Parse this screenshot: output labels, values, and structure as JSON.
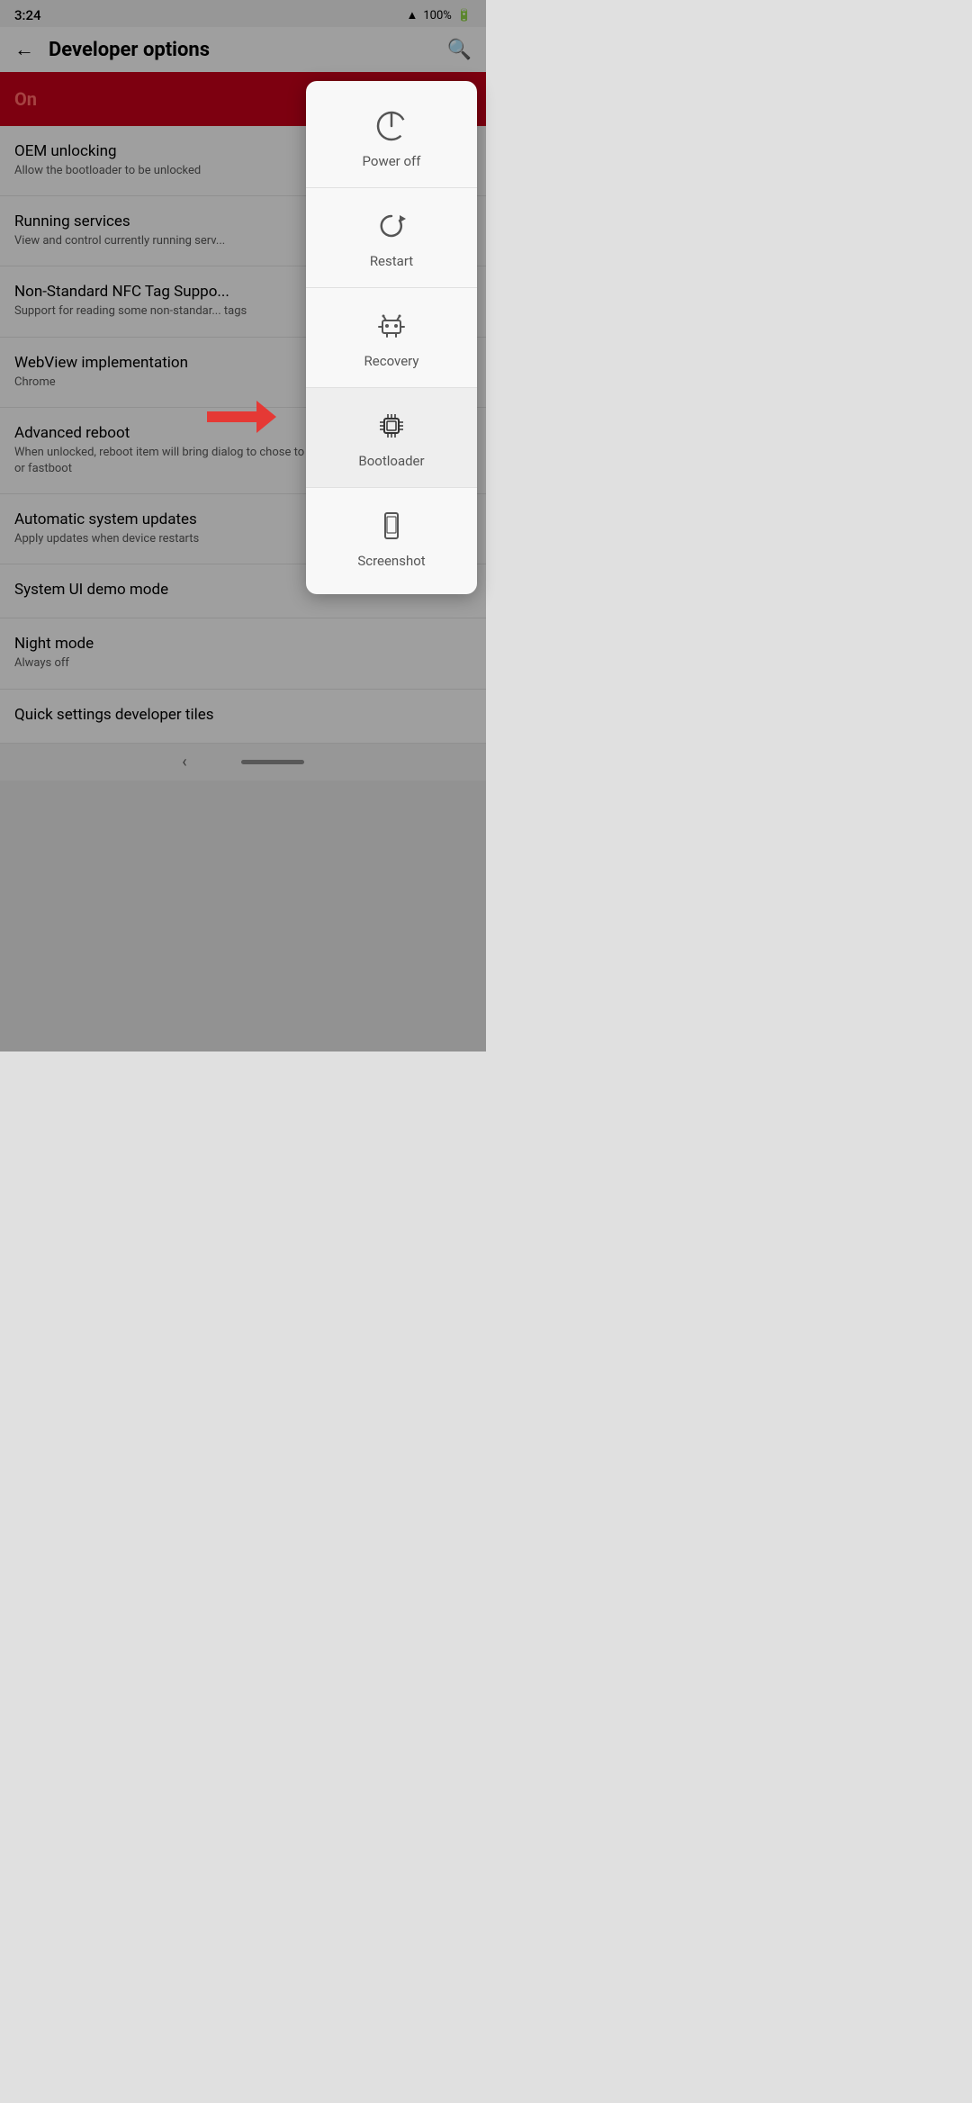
{
  "statusBar": {
    "time": "3:24",
    "battery": "100%"
  },
  "header": {
    "title": "Developer options",
    "backLabel": "←",
    "searchLabel": "🔍"
  },
  "onBanner": {
    "text": "On"
  },
  "settingsItems": [
    {
      "title": "OEM unlocking",
      "subtitle": "Allow the bootloader to be unlocked",
      "hasToggle": false
    },
    {
      "title": "Running services",
      "subtitle": "View and control currently running serv...",
      "hasToggle": false
    },
    {
      "title": "Non-Standard NFC Tag Suppo...",
      "subtitle": "Support for reading some non-standar... tags",
      "hasToggle": false
    },
    {
      "title": "WebView implementation",
      "subtitle": "Chrome",
      "hasToggle": false
    },
    {
      "title": "Advanced reboot",
      "subtitle": "When unlocked, reboot item will bring dialog to chose to reboot: normally, int... recovery or fastboot",
      "hasToggle": false
    },
    {
      "title": "Automatic system updates",
      "subtitle": "Apply updates when device restarts",
      "hasToggle": true
    },
    {
      "title": "System UI demo mode",
      "subtitle": "",
      "hasToggle": false
    },
    {
      "title": "Night mode",
      "subtitle": "Always off",
      "hasToggle": false
    },
    {
      "title": "Quick settings developer tiles",
      "subtitle": "",
      "hasToggle": false
    }
  ],
  "powerMenu": {
    "items": [
      {
        "id": "power-off",
        "label": "Power off"
      },
      {
        "id": "restart",
        "label": "Restart"
      },
      {
        "id": "recovery",
        "label": "Recovery"
      },
      {
        "id": "bootloader",
        "label": "Bootloader",
        "highlighted": true
      },
      {
        "id": "screenshot",
        "label": "Screenshot"
      }
    ]
  }
}
